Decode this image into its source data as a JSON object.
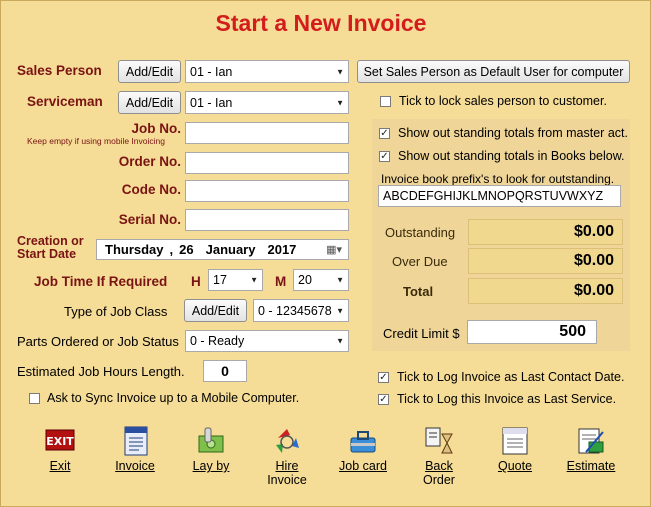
{
  "title": "Start a New Invoice",
  "sales_person": {
    "label": "Sales Person",
    "button": "Add/Edit",
    "value": "01 - Ian"
  },
  "default_user_button": "Set Sales Person as Default User for computer",
  "serviceman": {
    "label": "Serviceman",
    "button": "Add/Edit",
    "value": "01 - Ian"
  },
  "lock_checkbox": {
    "label": "Tick to lock sales person to customer.",
    "checked": false
  },
  "job_no": {
    "label": "Job No.",
    "hint": "Keep empty if using mobile Invoicing",
    "value": ""
  },
  "order_no": {
    "label": "Order No.",
    "value": ""
  },
  "code_no": {
    "label": "Code No.",
    "value": ""
  },
  "serial_no": {
    "label": "Serial No.",
    "value": ""
  },
  "creation": {
    "label_line1": "Creation or",
    "label_line2": "Start  Date",
    "weekday": "Thursday",
    "day": "26",
    "month": "January",
    "year": "2017"
  },
  "job_time": {
    "label": "Job Time If Required",
    "h_label": "H",
    "h_value": "17",
    "m_label": "M",
    "m_value": "20"
  },
  "job_class": {
    "label": "Type of Job Class",
    "button": "Add/Edit",
    "value": "0 - 12345678"
  },
  "parts_status": {
    "label": "Parts Ordered or Job Status",
    "value": "0 - Ready"
  },
  "est_hours": {
    "label": "Estimated Job Hours Length.",
    "value": "0"
  },
  "sync_checkbox": {
    "label": "Ask to Sync Invoice up to a Mobile Computer.",
    "checked": false
  },
  "panel": {
    "show_master": {
      "label": "Show out standing totals from master act.",
      "checked": true
    },
    "show_books": {
      "label": "Show out standing totals in Books below.",
      "checked": true
    },
    "prefix_label": "Invoice book prefix's to look for outstanding.",
    "prefix_value": "ABCDEFGHIJKLMNOPQRSTUVWXYZ",
    "outstanding": {
      "label": "Outstanding",
      "value": "$0.00"
    },
    "over_due": {
      "label": "Over Due",
      "value": "$0.00"
    },
    "total": {
      "label": "Total",
      "value": "$0.00"
    },
    "credit_limit": {
      "label": "Credit Limit $",
      "value": "500"
    }
  },
  "log_contact": {
    "label": "Tick to Log Invoice as Last Contact Date.",
    "checked": true
  },
  "log_service": {
    "label": "Tick to Log this Invoice as Last Service.",
    "checked": true
  },
  "toolbar": {
    "exit": "Exit",
    "invoice": "Invoice",
    "lay_by": "Lay by",
    "hire_1": "Hire",
    "hire_2": "Invoice",
    "job_card": "Job card",
    "back_1": "Back",
    "back_2": "Order",
    "quote": "Quote",
    "estimate": "Estimate"
  },
  "icons": {
    "exit": "exit-sign-icon",
    "invoice": "invoice-document-icon",
    "lay_by": "money-clip-icon",
    "hire": "recycle-arrows-icon",
    "job_card": "toolbox-icon",
    "back_order": "hourglass-icon",
    "quote": "quotes-document-icon",
    "estimate": "estimate-pen-icon"
  },
  "colors": {
    "title": "#d31c1c",
    "label": "#7a1414",
    "background": "#f5dc97"
  }
}
